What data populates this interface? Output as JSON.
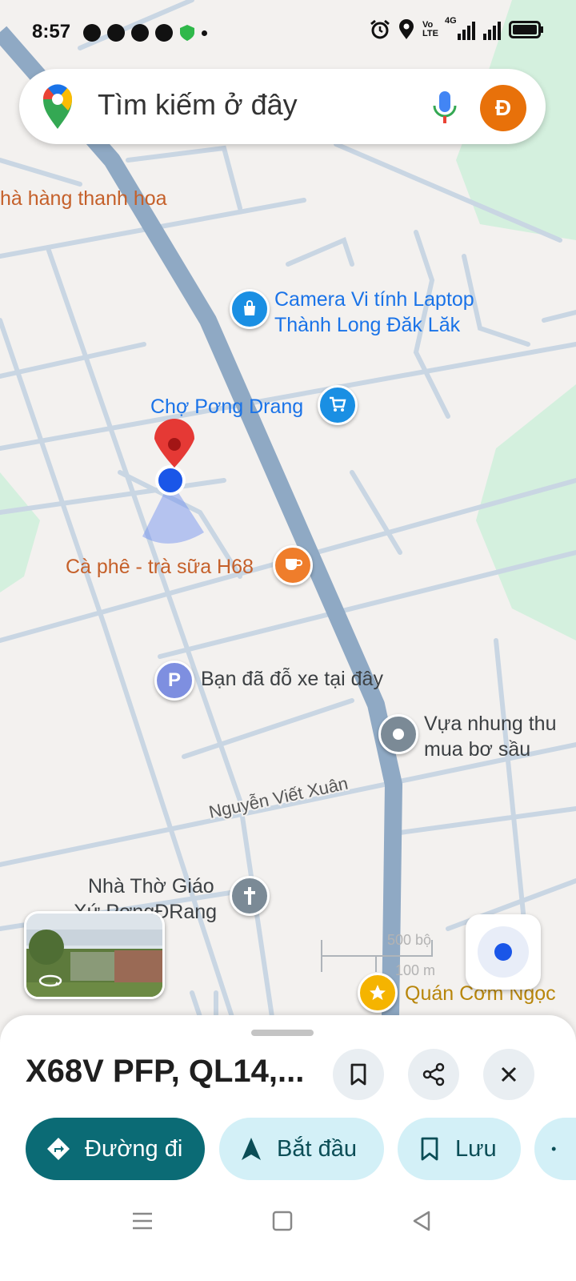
{
  "status_bar": {
    "time": "8:57",
    "network_label_top": "Vo",
    "network_label_bottom": "LTE",
    "data_type": "4G",
    "icons": [
      "messenger-icon",
      "messenger-icon",
      "messenger-icon",
      "messenger-icon",
      "shield-icon",
      "dot-icon",
      "alarm-icon",
      "location-icon",
      "signal-icon",
      "signal-icon",
      "battery-icon"
    ]
  },
  "search": {
    "placeholder": "Tìm kiếm ở đây",
    "avatar_letter": "Đ"
  },
  "map": {
    "places": [
      {
        "name": "hà hàng thanh hoa"
      },
      {
        "name_line1": "Camera Vi tính Laptop",
        "name_line2": "Thành Long Đăk Lăk",
        "icon": "shopping-bag-icon"
      },
      {
        "name": "Chợ Pơng Drang",
        "icon": "cart-icon"
      },
      {
        "name": "Cà phê - trà sữa H68",
        "icon": "coffee-icon"
      },
      {
        "name": "Bạn đã đỗ xe tại đây",
        "icon_letter": "P"
      },
      {
        "name_line1": "Vựa nhung thu",
        "name_line2": "mua bơ sầu",
        "icon": "generic-place-icon"
      },
      {
        "name_line1": "Nhà Thờ Giáo",
        "name_line2": "Xứ PơngĐRang",
        "icon": "church-cross-icon"
      },
      {
        "name": "Quán Cơm Ngọc",
        "icon": "star-icon"
      }
    ],
    "street_label": "Nguyễn Viết Xuân",
    "scale_top": "500 bộ",
    "scale_bottom": "100 m"
  },
  "colors": {
    "main_road": "#8fa9c4",
    "side_road": "#c9d6e3",
    "park": "#d4f0de",
    "primary_button": "#0b6b75",
    "secondary_button": "#d3f0f7",
    "red_pin": "#e53935",
    "location_dot": "#1a56e8"
  },
  "sheet": {
    "title": "X68V PFP, QL14,...",
    "buttons": [
      {
        "label": "Đường đi",
        "icon": "directions-icon"
      },
      {
        "label": "Bắt đầu",
        "icon": "navigation-arrow-icon"
      },
      {
        "label": "Lưu",
        "icon": "bookmark-icon"
      }
    ]
  }
}
